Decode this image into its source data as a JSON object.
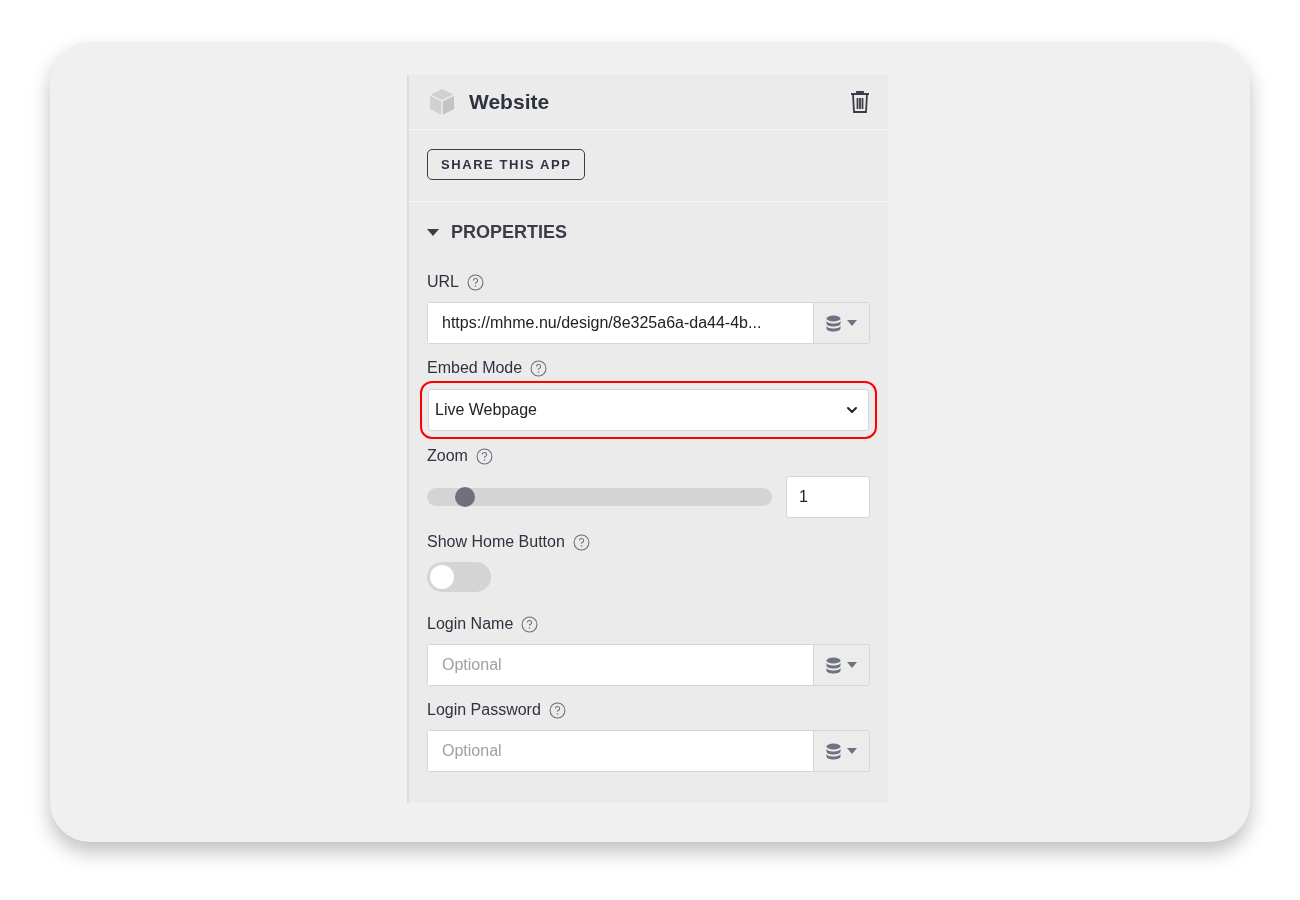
{
  "panel": {
    "title": "Website",
    "share_button": "SHARE THIS APP",
    "section": {
      "title": "PROPERTIES",
      "expanded": true
    },
    "properties": [
      {
        "kind": "text",
        "label": "URL",
        "value": "https://mhme.nu/design/8e325a6a-da44-4b...",
        "binding": true,
        "highlighted": false
      },
      {
        "kind": "select",
        "label": "Embed Mode",
        "value": "Live Webpage",
        "highlighted": true
      },
      {
        "kind": "slider",
        "label": "Zoom",
        "level": 0.11,
        "value": "1",
        "highlighted": false
      },
      {
        "kind": "toggle",
        "label": "Show Home Button",
        "on": false,
        "highlighted": false
      },
      {
        "kind": "text",
        "label": "Login Name",
        "placeholder": "Optional",
        "binding": true,
        "highlighted": false
      },
      {
        "kind": "text",
        "label": "Login Password",
        "placeholder": "Optional",
        "binding": true,
        "highlighted": false
      }
    ]
  }
}
